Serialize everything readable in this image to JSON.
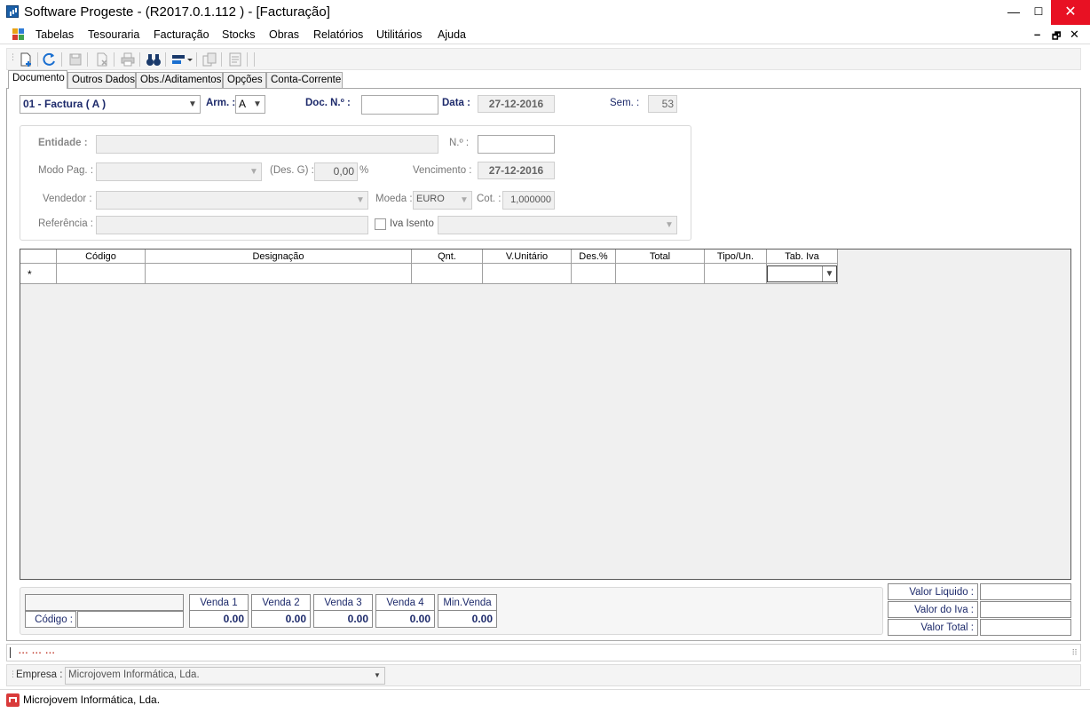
{
  "window": {
    "title": "Software Progeste - (R2017.0.1.112 ) - [Facturação]",
    "minimize_glyph": "—",
    "maximize_glyph": "☐",
    "close_glyph": "✕"
  },
  "menu": {
    "items": [
      "Tabelas",
      "Tesouraria",
      "Facturação",
      "Stocks",
      "Obras",
      "Relatórios",
      "Utilitários",
      "Ajuda"
    ],
    "mdi_minimize": "–",
    "mdi_restore": "🗗",
    "mdi_close": "✕"
  },
  "tabs": [
    "Documento",
    "Outros Dados",
    "Obs./Aditamentos",
    "Opções",
    "Conta-Corrente"
  ],
  "document": {
    "doc_type": "01 - Factura ( A )",
    "arm_label": "Arm. :",
    "arm_value": "A",
    "doc_no_label": "Doc. N.º :",
    "doc_no_value": "",
    "data_label": "Data :",
    "data_value": "27-12-2016",
    "sem_label": "Sem. :",
    "sem_value": "53"
  },
  "entity": {
    "entidade_label": "Entidade :",
    "no_label": "N.º :",
    "modo_pag_label": "Modo Pag. :",
    "des_g_label": "(Des. G) :",
    "des_g_value": "0,00",
    "des_g_unit": "%",
    "vencimento_label": "Vencimento :",
    "vencimento_value": "27-12-2016",
    "vendedor_label": "Vendedor :",
    "moeda_label": "Moeda :",
    "moeda_value": "EURO",
    "cot_label": "Cot. :",
    "cot_value": "1,000000",
    "referencia_label": "Referência :",
    "iva_isento_label": "Iva Isento"
  },
  "grid": {
    "columns": [
      "Código",
      "Designação",
      "Qnt.",
      "V.Unitário",
      "Des.%",
      "Total",
      "Tipo/Un.",
      "Tab. Iva"
    ],
    "new_row_marker": "*"
  },
  "sales": {
    "codigo_label": "Código :",
    "boxes": [
      {
        "label": "Venda 1",
        "value": "0.00"
      },
      {
        "label": "Venda 2",
        "value": "0.00"
      },
      {
        "label": "Venda 3",
        "value": "0.00"
      },
      {
        "label": "Venda 4",
        "value": "0.00"
      },
      {
        "label": "Min.Venda",
        "value": "0.00"
      }
    ]
  },
  "totals": {
    "valor_liquido": "Valor Liquido :",
    "valor_iva": "Valor do Iva :",
    "valor_total": "Valor Total :"
  },
  "status": {
    "strip_text": "... ... ...",
    "empresa_label": "Empresa :",
    "empresa_value": "Microjovem Informática, Lda.",
    "footer_text": "Microjovem Informática, Lda."
  },
  "colors": {
    "accent_label": "#1d2a6b",
    "close_button": "#e81123",
    "status_red": "#c0392b"
  }
}
